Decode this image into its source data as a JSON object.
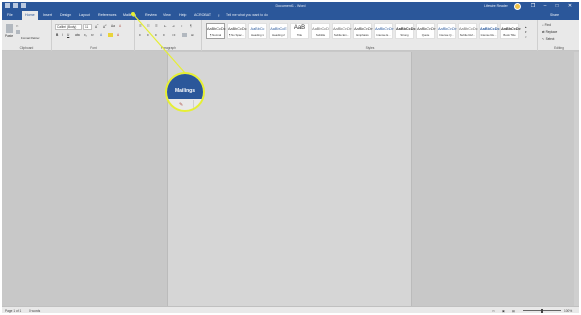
{
  "window": {
    "title": "Document1 - Word",
    "user_name": "Lifewire Reader",
    "user_initial": "L",
    "buttons": {
      "restore": "❐",
      "minimize": "–",
      "maximize": "□",
      "close": "✕"
    }
  },
  "tabs": [
    {
      "label": "File"
    },
    {
      "label": "Home"
    },
    {
      "label": "Insert"
    },
    {
      "label": "Design"
    },
    {
      "label": "Layout"
    },
    {
      "label": "References"
    },
    {
      "label": "Mailings"
    },
    {
      "label": "Review"
    },
    {
      "label": "View"
    },
    {
      "label": "Help"
    },
    {
      "label": "ACROBAT"
    }
  ],
  "tell_me": "Tell me what you want to do",
  "share": "Share",
  "ribbon": {
    "clipboard": {
      "label": "Clipboard",
      "paste": "Paste",
      "format_painter": "Format Painter"
    },
    "font": {
      "label": "Font",
      "family": "Calibri (Body)",
      "size": "11"
    },
    "paragraph": {
      "label": "Paragraph"
    },
    "styles": {
      "label": "Styles",
      "items": [
        {
          "sample": "AaBbCcDc",
          "name": "¶ Normal"
        },
        {
          "sample": "AaBbCcDc",
          "name": "¶ No Spac..."
        },
        {
          "sample": "AaBbCc",
          "name": "Heading 1"
        },
        {
          "sample": "AaBbCcE",
          "name": "Heading 2"
        },
        {
          "sample": "AaB",
          "name": "Title"
        },
        {
          "sample": "AaBbCcD",
          "name": "Subtitle"
        },
        {
          "sample": "AaBbCcDc",
          "name": "Subtle Em..."
        },
        {
          "sample": "AaBbCcDc",
          "name": "Emphasis"
        },
        {
          "sample": "AaBbCcDc",
          "name": "Intense E..."
        },
        {
          "sample": "AaBbCcDc",
          "name": "Strong"
        },
        {
          "sample": "AaBbCcDc",
          "name": "Quote"
        },
        {
          "sample": "AaBbCcDc",
          "name": "Intense Q..."
        },
        {
          "sample": "AaBbCcDc",
          "name": "Subtle Ref..."
        },
        {
          "sample": "AaBbCcDc",
          "name": "Intense Re..."
        },
        {
          "sample": "AaBbCcDc",
          "name": "Book Title"
        }
      ]
    },
    "editing": {
      "label": "Editing",
      "find": "Find",
      "replace": "Replace",
      "select": "Select"
    }
  },
  "status": {
    "page": "Page 1 of 1",
    "words": "0 words",
    "zoom": "100%"
  },
  "callout": {
    "label": "Mailings",
    "accent": "#e6ef33"
  },
  "colors": {
    "word_blue": "#2b579a",
    "ribbon": "#e9e9e9",
    "canvas": "#c8c8c8"
  }
}
